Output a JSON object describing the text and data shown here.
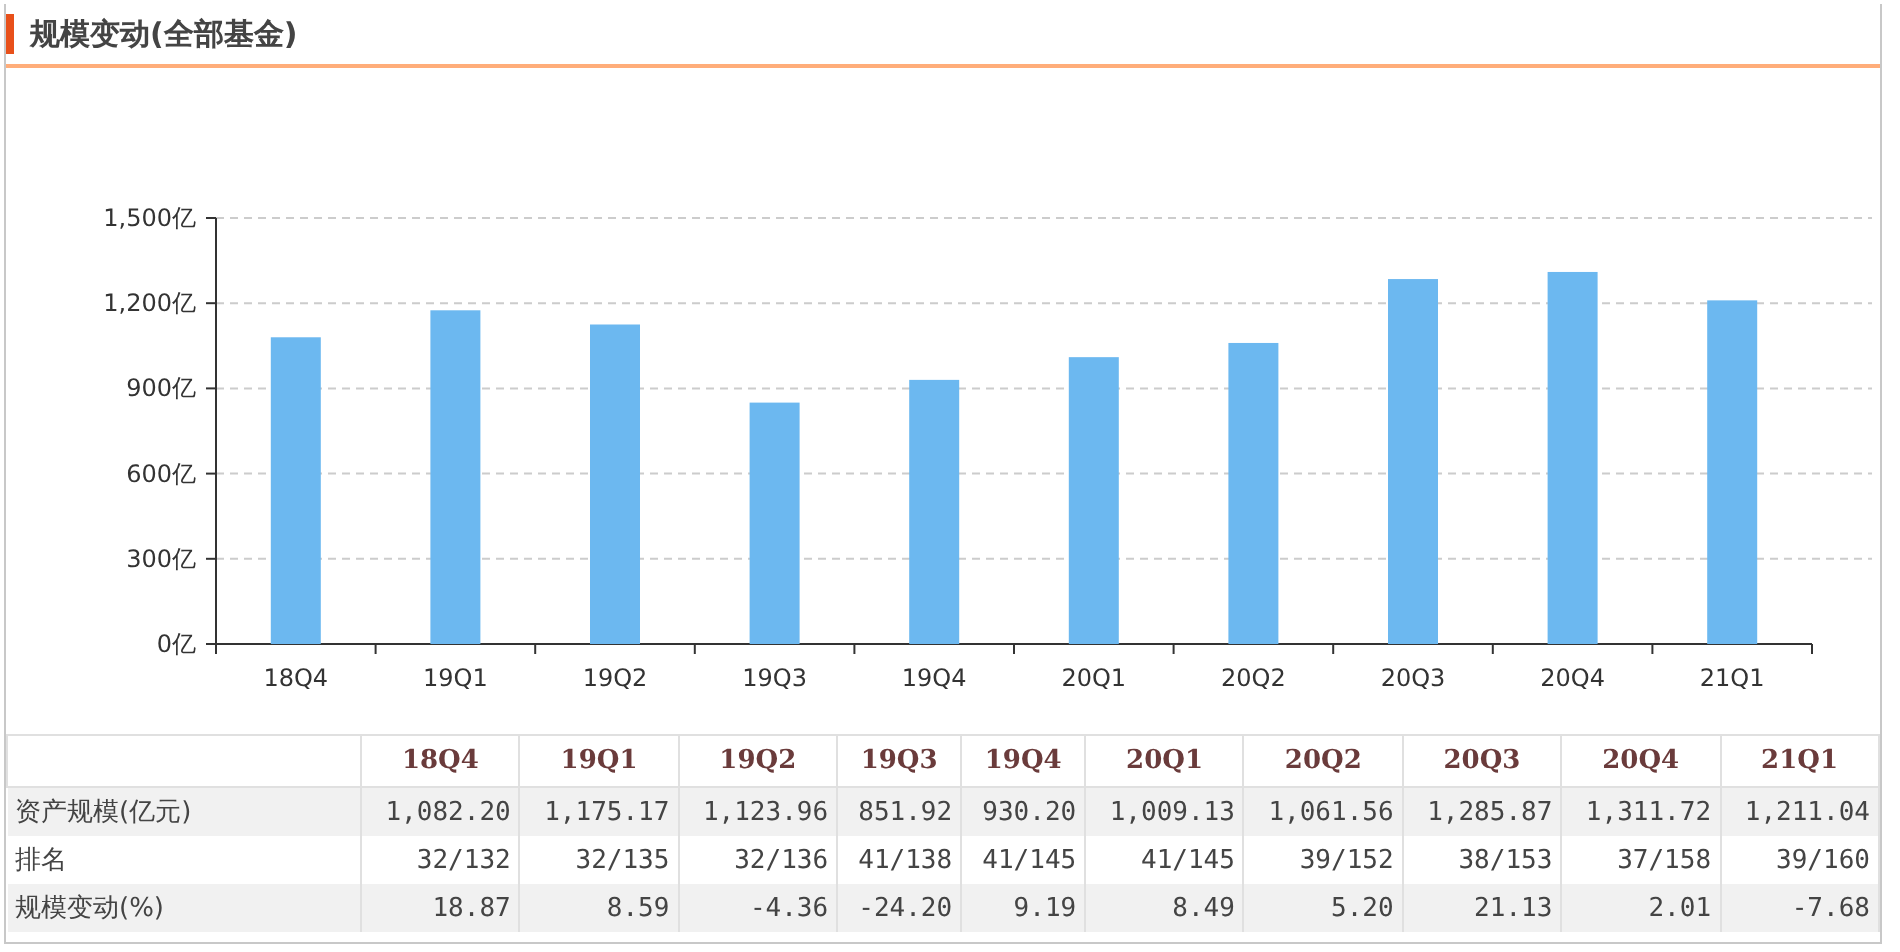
{
  "title": "规模变动(全部基金)",
  "chart_data": {
    "type": "bar",
    "categories": [
      "18Q4",
      "19Q1",
      "19Q2",
      "19Q3",
      "19Q4",
      "20Q1",
      "20Q2",
      "20Q3",
      "20Q4",
      "21Q1"
    ],
    "series": [
      {
        "color": "#6cb8f0",
        "values": [
          1080,
          1175,
          1125,
          850,
          930,
          1010,
          1060,
          1285,
          1310,
          1210
        ]
      }
    ],
    "grid": true,
    "ylim": [
      0,
      1500
    ],
    "yticks": [
      {
        "value": 0,
        "label": "0亿"
      },
      {
        "value": 300,
        "label": "300亿"
      },
      {
        "value": 600,
        "label": "600亿"
      },
      {
        "value": 900,
        "label": "900亿"
      },
      {
        "value": 1200,
        "label": "1,200亿"
      },
      {
        "value": 1500,
        "label": "1,500亿"
      }
    ]
  },
  "table": {
    "columns": [
      "18Q4",
      "19Q1",
      "19Q2",
      "19Q3",
      "19Q4",
      "20Q1",
      "20Q2",
      "20Q3",
      "20Q4",
      "21Q1"
    ],
    "rows": [
      {
        "label": "资产规模(亿元)",
        "cells": [
          "1,082.20",
          "1,175.17",
          "1,123.96",
          "851.92",
          "930.20",
          "1,009.13",
          "1,061.56",
          "1,285.87",
          "1,311.72",
          "1,211.04"
        ]
      },
      {
        "label": "排名",
        "cells": [
          "32/132",
          "32/135",
          "32/136",
          "41/138",
          "41/145",
          "41/145",
          "39/152",
          "38/153",
          "37/158",
          "39/160"
        ]
      },
      {
        "label": "规模变动(%)",
        "cells": [
          "18.87",
          "8.59",
          "-4.36",
          "-24.20",
          "9.19",
          "8.49",
          "5.20",
          "21.13",
          "2.01",
          "-7.68"
        ]
      }
    ]
  }
}
